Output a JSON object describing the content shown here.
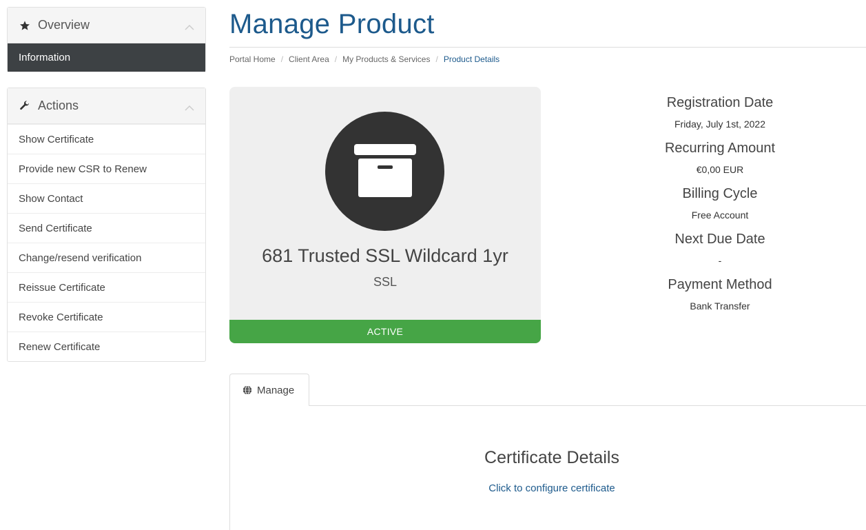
{
  "sidebar": {
    "overview": {
      "title": "Overview",
      "icon": "star-icon",
      "active_item": "Information"
    },
    "actions": {
      "title": "Actions",
      "icon": "wrench-icon",
      "items": [
        "Show Certificate",
        "Provide new CSR to Renew",
        "Show Contact",
        "Send Certificate",
        "Change/resend verification",
        "Reissue Certificate",
        "Revoke Certificate",
        "Renew Certificate"
      ]
    }
  },
  "page": {
    "title": "Manage Product",
    "breadcrumb": [
      "Portal Home",
      "Client Area",
      "My Products & Services",
      "Product Details"
    ]
  },
  "product": {
    "icon": "archive-box-icon",
    "name": "681 Trusted SSL Wildcard 1yr",
    "group": "SSL",
    "status": "ACTIVE",
    "status_color": "#46a546"
  },
  "details": [
    {
      "label": "Registration Date",
      "value": "Friday, July 1st, 2022"
    },
    {
      "label": "Recurring Amount",
      "value": "€0,00 EUR"
    },
    {
      "label": "Billing Cycle",
      "value": "Free Account"
    },
    {
      "label": "Next Due Date",
      "value": "-"
    },
    {
      "label": "Payment Method",
      "value": "Bank Transfer"
    }
  ],
  "tabs": [
    {
      "label": "Manage",
      "icon": "globe-icon"
    }
  ],
  "certificate": {
    "title": "Certificate Details",
    "link": "Click to configure certificate"
  },
  "colors": {
    "brand": "#1d5a8c",
    "sidebar_active": "#3d4144"
  }
}
